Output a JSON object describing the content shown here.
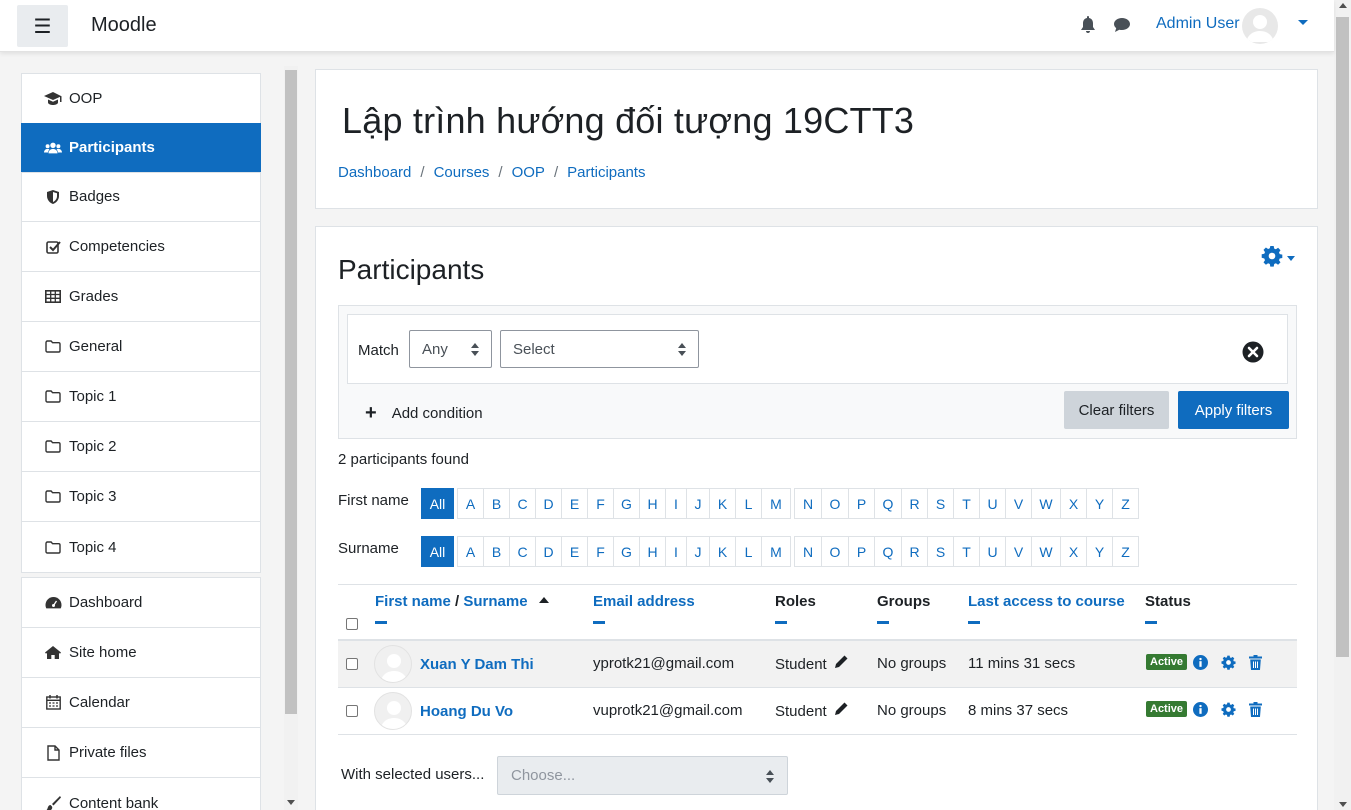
{
  "navbar": {
    "brand": "Moodle",
    "user_name": "Admin User"
  },
  "drawer": {
    "course_items": [
      {
        "label": "OOP",
        "icon": "graduation-cap-icon"
      },
      {
        "label": "Participants",
        "icon": "users-icon",
        "active": true
      },
      {
        "label": "Badges",
        "icon": "shield-icon"
      },
      {
        "label": "Competencies",
        "icon": "check-square-icon"
      },
      {
        "label": "Grades",
        "icon": "table-icon"
      },
      {
        "label": "General",
        "icon": "folder-icon"
      },
      {
        "label": "Topic 1",
        "icon": "folder-icon"
      },
      {
        "label": "Topic 2",
        "icon": "folder-icon"
      },
      {
        "label": "Topic 3",
        "icon": "folder-icon"
      },
      {
        "label": "Topic 4",
        "icon": "folder-icon"
      }
    ],
    "site_items": [
      {
        "label": "Dashboard",
        "icon": "tachometer-icon"
      },
      {
        "label": "Site home",
        "icon": "home-icon"
      },
      {
        "label": "Calendar",
        "icon": "calendar-icon"
      },
      {
        "label": "Private files",
        "icon": "file-icon"
      },
      {
        "label": "Content bank",
        "icon": "paintbrush-icon"
      }
    ]
  },
  "header": {
    "course_title": "Lập trình hướng đối tượng 19CTT3",
    "breadcrumb": [
      "Dashboard",
      "Courses",
      "OOP",
      "Participants"
    ]
  },
  "participants": {
    "heading": "Participants",
    "filter": {
      "match_label": "Match",
      "match_value": "Any",
      "select_value": "Select",
      "add_condition": "Add condition",
      "clear_filters": "Clear filters",
      "apply_filters": "Apply filters"
    },
    "found_text": "2 participants found",
    "first_name_label": "First name",
    "surname_label": "Surname",
    "all_label": "All",
    "letters": [
      "A",
      "B",
      "C",
      "D",
      "E",
      "F",
      "G",
      "H",
      "I",
      "J",
      "K",
      "L",
      "M",
      "N",
      "O",
      "P",
      "Q",
      "R",
      "S",
      "T",
      "U",
      "V",
      "W",
      "X",
      "Y",
      "Z"
    ],
    "columns": {
      "first_name": "First name",
      "slash": "/",
      "surname": "Surname",
      "email": "Email address",
      "roles": "Roles",
      "groups": "Groups",
      "last_access": "Last access to course",
      "status": "Status"
    },
    "rows": [
      {
        "name": "Xuan Y Dam Thi",
        "email": "yprotk21@gmail.com",
        "role": "Student",
        "groups": "No groups",
        "last_access": "11 mins 31 secs",
        "status": "Active"
      },
      {
        "name": "Hoang Du Vo",
        "email": "vuprotk21@gmail.com",
        "role": "Student",
        "groups": "No groups",
        "last_access": "8 mins 37 secs",
        "status": "Active"
      }
    ],
    "with_selected_label": "With selected users...",
    "choose_placeholder": "Choose..."
  },
  "colors": {
    "primary": "#0f6cbf",
    "active_badge": "#357a32"
  }
}
